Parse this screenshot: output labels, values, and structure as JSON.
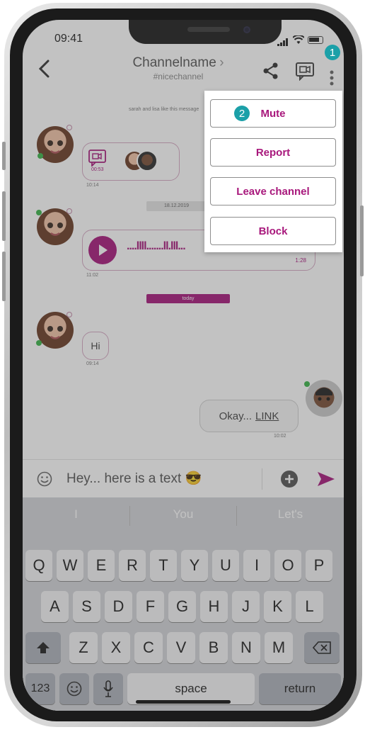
{
  "status_bar": {
    "time": "09:41"
  },
  "header": {
    "channel_name": "Channelname",
    "channel_tag": "#nicechannel",
    "chevron": "›"
  },
  "chat": {
    "system_note": "sarah and lisa like this message",
    "video_duration": "00:53",
    "msg1_time": "10:14",
    "date_label": "18.12.2019",
    "voice_duration": "1:28",
    "voice_time": "11:02",
    "waveform": "....llll.......ll.lll...",
    "today_label": "today",
    "hi_text": "Hi",
    "hi_time": "09:14",
    "okay_text": "Okay...",
    "okay_link": "LINK",
    "okay_time": "10:02"
  },
  "composer": {
    "text": "Hey... here is a text",
    "emoji": "😎"
  },
  "keyboard": {
    "suggestions": [
      "I",
      "You",
      "Let's"
    ],
    "row1": [
      "Q",
      "W",
      "E",
      "R",
      "T",
      "Y",
      "U",
      "I",
      "O",
      "P"
    ],
    "row2": [
      "A",
      "S",
      "D",
      "F",
      "G",
      "H",
      "J",
      "K",
      "L"
    ],
    "row3": [
      "Z",
      "X",
      "C",
      "V",
      "B",
      "N",
      "M"
    ],
    "numbers_key": "123",
    "space_key": "space",
    "return_key": "return"
  },
  "menu": {
    "items": [
      "Mute",
      "Report",
      "Leave channel",
      "Block"
    ],
    "badges": [
      "1",
      "2"
    ]
  },
  "colors": {
    "accent": "#a8187c",
    "badge": "#1ba0a8",
    "online": "#3bb54a"
  }
}
